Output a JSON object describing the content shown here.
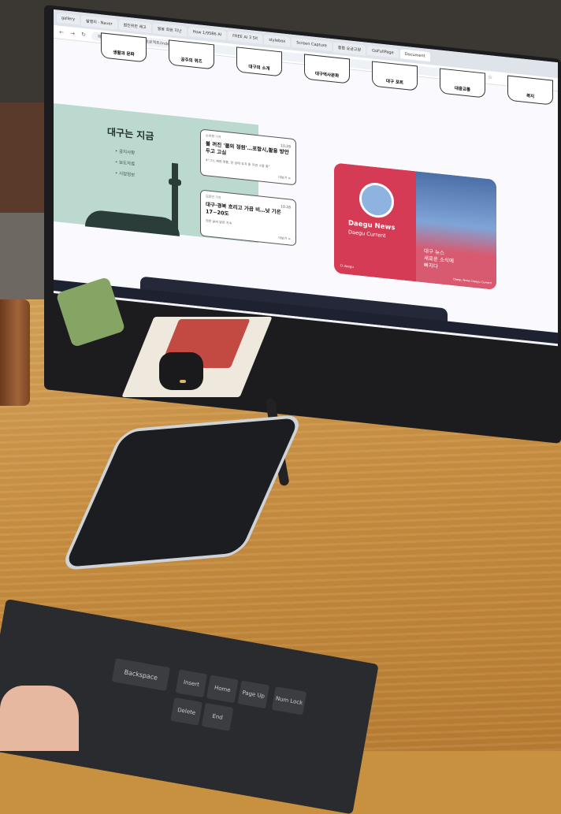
{
  "browser": {
    "tabs": [
      "gallery",
      "발행지 · Naver",
      "범진위한 레고",
      "월봉 회원 지난",
      "How 1/9586 AI",
      "FREE AI 3 Sit",
      "stylebox",
      "Screen Capture",
      "통합 요금고양",
      "GoFullPage",
      "Document"
    ],
    "active_tab_index": 10,
    "address": "파일 | file:///D:/학습자료/웹프로젝트/index.html"
  },
  "site": {
    "nav": [
      "생활과 문화",
      "공주의 퀴즈",
      "대구의 소개",
      "대구역사문화",
      "대구 포트",
      "대중교통",
      "복지"
    ],
    "section_title": "대구는 지금",
    "section_links": [
      "공지사항",
      "보도자료",
      "시정정보"
    ],
    "cards": [
      {
        "tag": "손대평 기자",
        "date": "10.28",
        "headline": "불 꺼진 '불의 정원'…포항시,활용 방안 두고 고심",
        "summary": "4\"그스 재관 연동, 한 상태 유지 등 지관 수용 중\"",
        "more": "더보기 >"
      },
      {
        "tag": "김종민 기자",
        "date": "10.28",
        "headline": "대구·경북 흐리고 가끔 비…낮 기온 17~20도",
        "summary": "전반 날씨 맑은 지속",
        "more": "더보기 >"
      }
    ],
    "news_card": {
      "title": "Daegu News",
      "subtitle": "Daegu Current",
      "caption_lines": [
        "대구 뉴스",
        "새로운 소식에",
        "빠지다"
      ],
      "brand": "D  daegu",
      "footer": "Daegu News  Daegu Current"
    }
  },
  "keyboard": {
    "keys": [
      "Backspace",
      "Insert",
      "Home",
      "Page Up",
      "Num Lock",
      "Delete",
      "End"
    ]
  }
}
